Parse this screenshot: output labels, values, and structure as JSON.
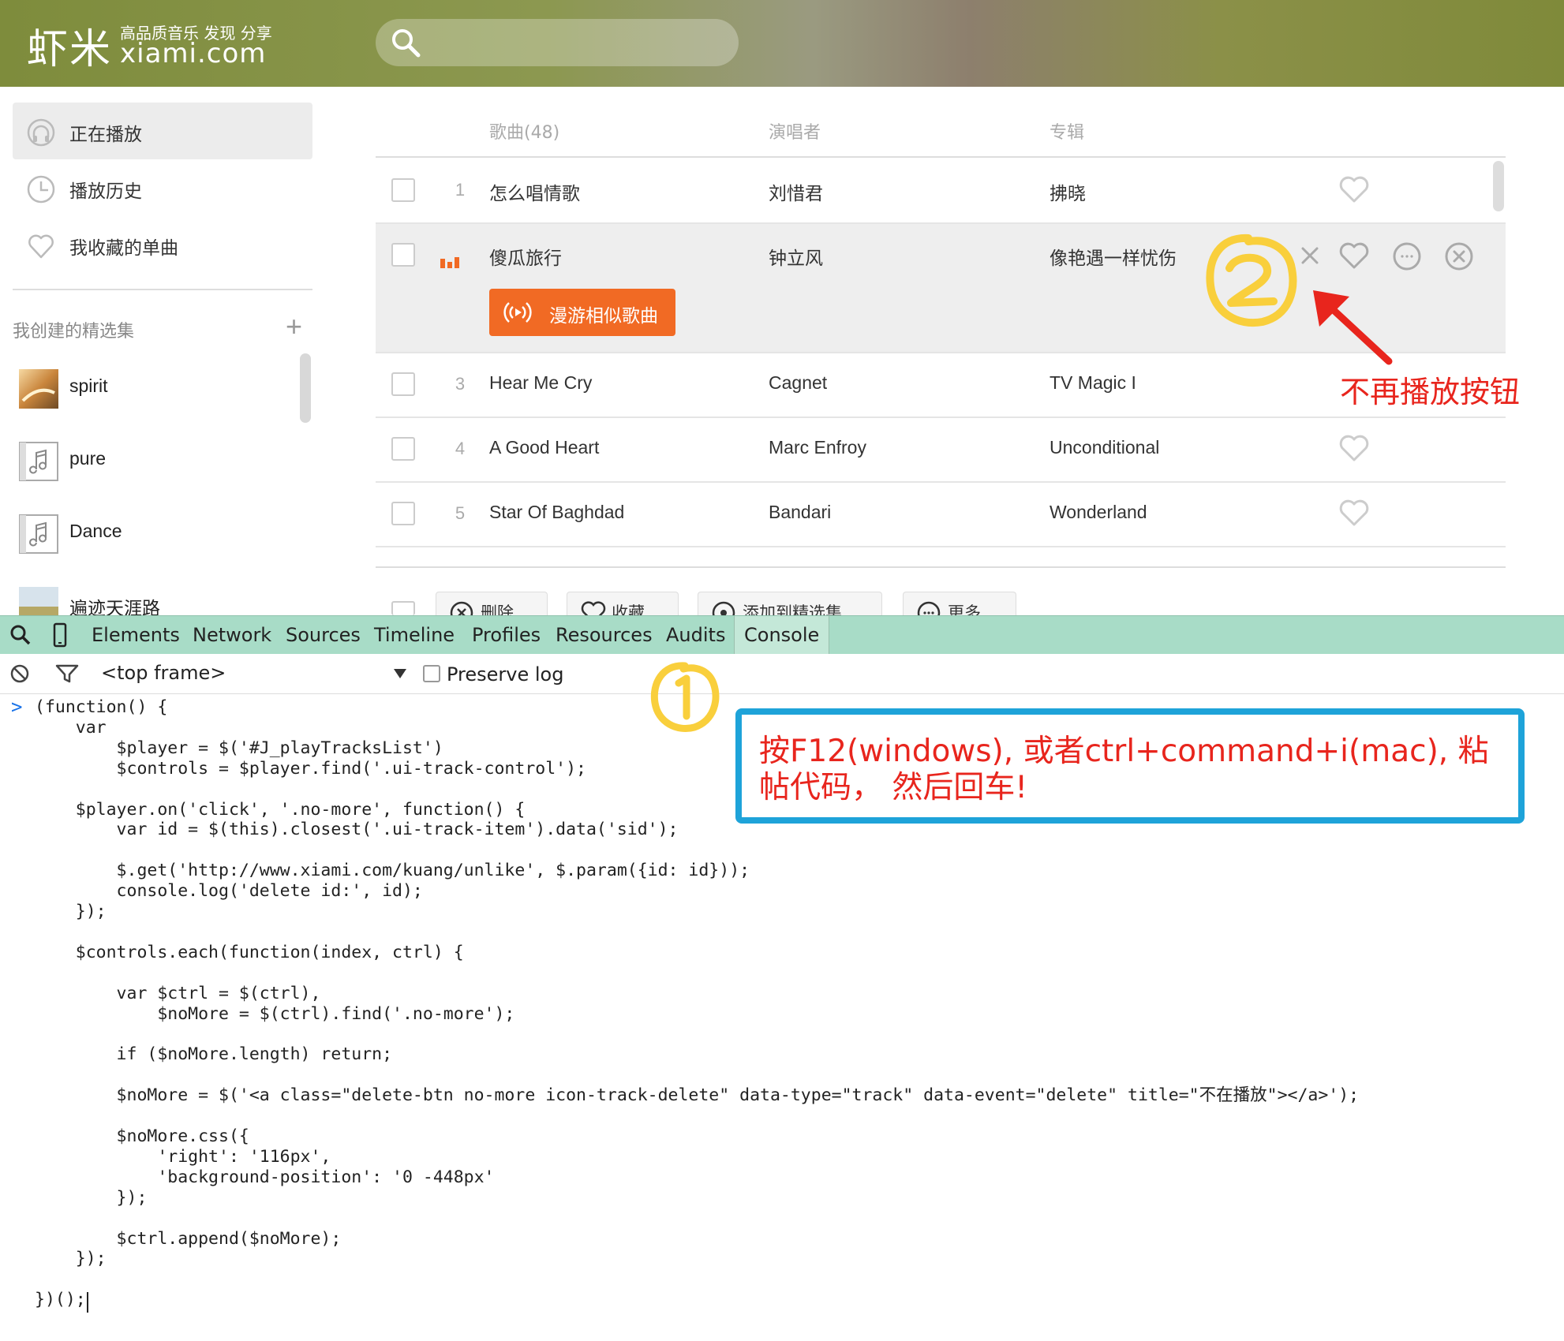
{
  "header": {
    "logo_cn": "虾米",
    "logo_slogan": "高品质音乐 发现 分享",
    "logo_en": "xiami.com",
    "search_placeholder": ""
  },
  "sidebar": {
    "items": [
      {
        "label": "正在播放",
        "icon": "headphones-icon"
      },
      {
        "label": "播放历史",
        "icon": "clock-icon"
      },
      {
        "label": "我收藏的单曲",
        "icon": "heart-icon"
      }
    ],
    "section_title": "我创建的精选集",
    "add_symbol": "+",
    "collections": [
      {
        "label": "spirit",
        "icon": "album-thumb"
      },
      {
        "label": "pure",
        "icon": "music-note-icon"
      },
      {
        "label": "Dance",
        "icon": "music-note-icon"
      },
      {
        "label": "遍迹天涯路",
        "icon": "album-thumb"
      }
    ]
  },
  "tracklist": {
    "headers": {
      "song": "歌曲(48)",
      "artist": "演唱者",
      "album": "专辑"
    },
    "rows": [
      {
        "num": "1",
        "song": "怎么唱情歌",
        "artist": "刘惜君",
        "album": "拂晓"
      },
      {
        "num": "",
        "song": "傻瓜旅行",
        "artist": "钟立风",
        "album": "像艳遇一样忧伤",
        "playing": true
      },
      {
        "num": "3",
        "song": "Hear Me Cry",
        "artist": "Cagnet",
        "album": "TV Magic I"
      },
      {
        "num": "4",
        "song": "A Good Heart",
        "artist": "Marc Enfroy",
        "album": "Unconditional"
      },
      {
        "num": "5",
        "song": "Star Of Baghdad",
        "artist": "Bandari",
        "album": "Wonderland"
      }
    ],
    "roam_button": "漫游相似歌曲",
    "actions": [
      "删除",
      "收藏",
      "添加到精选集",
      "更多"
    ]
  },
  "devtools": {
    "tabs": [
      "Elements",
      "Network",
      "Sources",
      "Timeline",
      "Profiles",
      "Resources",
      "Audits",
      "Console"
    ],
    "active_tab": "Console",
    "frame_select": "<top frame>",
    "preserve_log": "Preserve log",
    "prompt": ">",
    "code": "(function() {\n    var\n        $player = $('#J_playTracksList')\n        $controls = $player.find('.ui-track-control');\n\n    $player.on('click', '.no-more', function() {\n        var id = $(this).closest('.ui-track-item').data('sid');\n\n        $.get('http://www.xiami.com/kuang/unlike', $.param({id: id}));\n        console.log('delete id:', id);\n    });\n\n    $controls.each(function(index, ctrl) {\n\n        var $ctrl = $(ctrl),\n            $noMore = $(ctrl).find('.no-more');\n\n        if ($noMore.length) return;\n\n        $noMore = $('<a class=\"delete-btn no-more icon-track-delete\" data-type=\"track\" data-event=\"delete\" title=\"不在播放\"></a>');\n\n        $noMore.css({\n            'right': '116px',\n            'background-position': '0 -448px'\n        });\n\n        $ctrl.append($noMore);\n    });\n\n})();"
  },
  "annotations": {
    "instruction": "按F12(windows), 或者ctrl+command+i(mac), 粘帖代码， 然后回车!",
    "no_replay_label": "不再播放按钮",
    "marker_1": "1",
    "marker_2": "2",
    "colors": {
      "red": "#e8251d",
      "blue": "#1ea3d9",
      "yellow": "#f9cf3c",
      "orange": "#f16a24"
    }
  }
}
